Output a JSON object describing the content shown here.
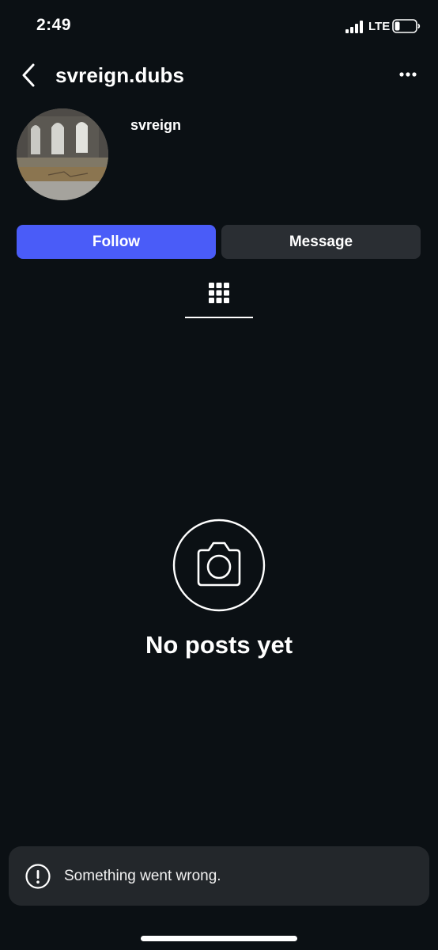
{
  "status_bar": {
    "time": "2:49",
    "network": "LTE",
    "icons": [
      "signal-icon",
      "battery-icon"
    ]
  },
  "header": {
    "username": "svreign.dubs",
    "icons": [
      "back-arrow-icon",
      "more-options-icon"
    ]
  },
  "profile": {
    "display_name": "svreign"
  },
  "actions": {
    "follow_label": "Follow",
    "message_label": "Message"
  },
  "tabs": {
    "icons": [
      "grid-icon"
    ]
  },
  "empty_state": {
    "icon": "camera-icon",
    "title": "No posts yet"
  },
  "toast": {
    "icon": "exclamation-icon",
    "message": "Something went wrong."
  },
  "colors": {
    "background": "#0b1014",
    "follow_button": "#4a5cf8",
    "message_button": "#2a2e33",
    "toast_background": "#23272b"
  }
}
